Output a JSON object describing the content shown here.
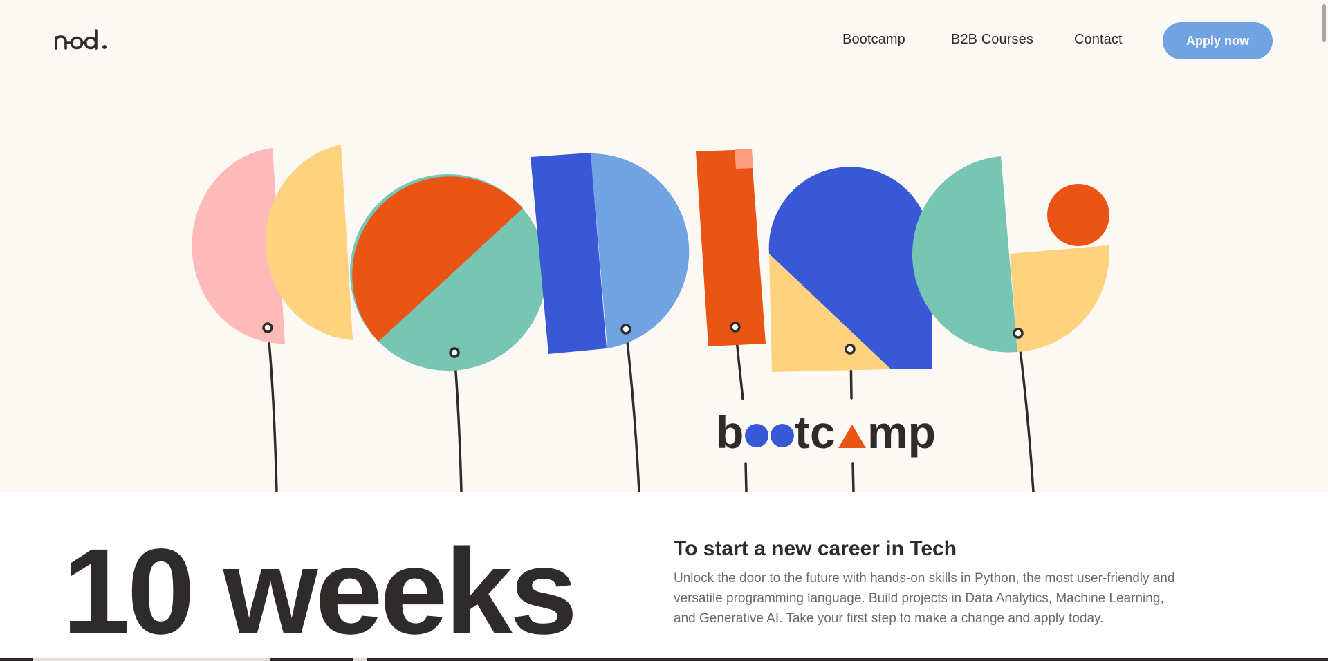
{
  "brand": {
    "logo_text": "nod."
  },
  "nav": {
    "links": [
      "Bootcamp",
      "B2B Courses",
      "Contact"
    ],
    "apply_label": "Apply now"
  },
  "hero": {
    "artwork_word": "coding",
    "badge_text": "bootcamp"
  },
  "intro": {
    "duration": "10 weeks",
    "title": "To start a new career in Tech",
    "description": "Unlock the door to the future with hands-on skills in Python, the most user-friendly and versatile programming language. Build projects in Data Analytics, Machine Learning, and Generative AI. Take your first step to make a change and apply today."
  },
  "colors": {
    "background": "#fcf8f4",
    "accent_blue": "#71a2e2",
    "deep_blue": "#3858d6",
    "orange": "#ea5415",
    "teal": "#77c6b3",
    "yellow": "#fed27e",
    "pink": "#feb9b9",
    "text": "#2f2b2b"
  }
}
